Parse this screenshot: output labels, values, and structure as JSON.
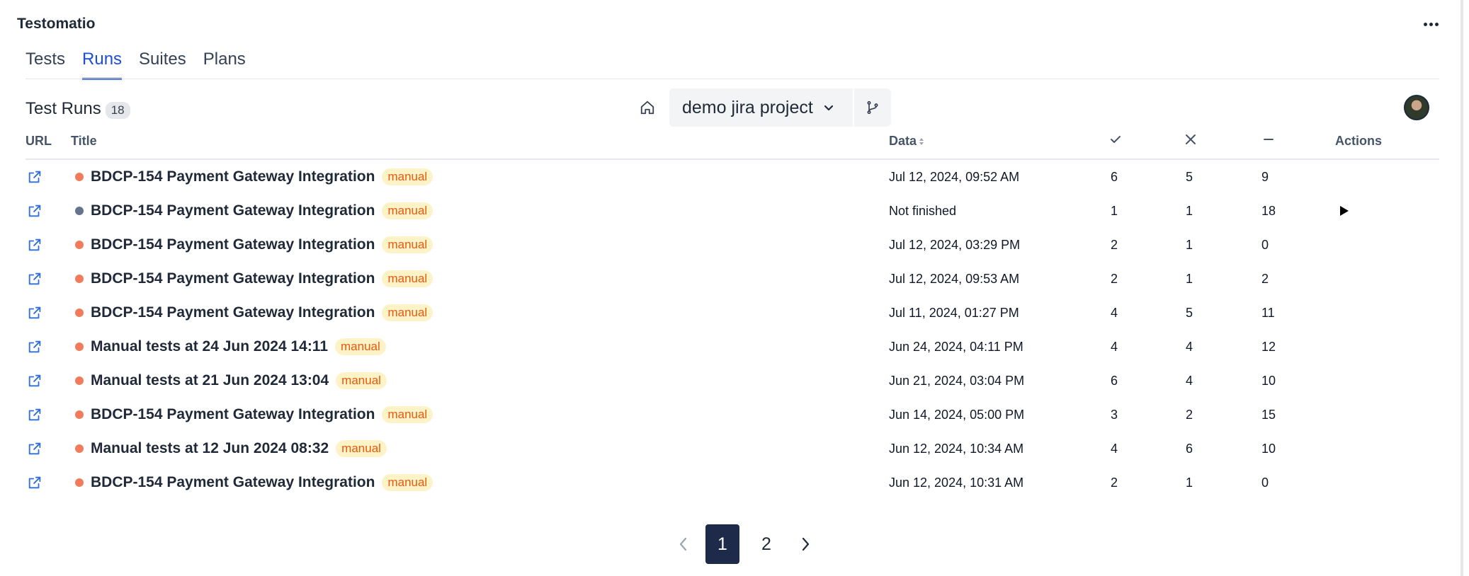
{
  "app": {
    "title": "Testomatio"
  },
  "tabs": [
    {
      "label": "Tests"
    },
    {
      "label": "Runs"
    },
    {
      "label": "Suites"
    },
    {
      "label": "Plans"
    }
  ],
  "header": {
    "title": "Test Runs",
    "count": "18",
    "project": "demo jira project"
  },
  "columns": {
    "url": "URL",
    "title": "Title",
    "date": "Data",
    "actions": "Actions"
  },
  "status_colors": {
    "finished": "#f07c5a",
    "unfinished": "#64748b"
  },
  "rows": [
    {
      "title": "BDCP-154 Payment Gateway Integration",
      "badge": "manual",
      "date": "Jul 12, 2024, 09:52 AM",
      "passed": "6",
      "failed": "5",
      "skipped": "9",
      "status": "finished"
    },
    {
      "title": "BDCP-154 Payment Gateway Integration",
      "badge": "manual",
      "date": "Not finished",
      "passed": "1",
      "failed": "1",
      "skipped": "18",
      "status": "unfinished"
    },
    {
      "title": "BDCP-154 Payment Gateway Integration",
      "badge": "manual",
      "date": "Jul 12, 2024, 03:29 PM",
      "passed": "2",
      "failed": "1",
      "skipped": "0",
      "status": "finished"
    },
    {
      "title": "BDCP-154 Payment Gateway Integration",
      "badge": "manual",
      "date": "Jul 12, 2024, 09:53 AM",
      "passed": "2",
      "failed": "1",
      "skipped": "2",
      "status": "finished"
    },
    {
      "title": "BDCP-154 Payment Gateway Integration",
      "badge": "manual",
      "date": "Jul 11, 2024, 01:27 PM",
      "passed": "4",
      "failed": "5",
      "skipped": "11",
      "status": "finished"
    },
    {
      "title": "Manual tests at 24 Jun 2024 14:11",
      "badge": "manual",
      "date": "Jun 24, 2024, 04:11 PM",
      "passed": "4",
      "failed": "4",
      "skipped": "12",
      "status": "finished"
    },
    {
      "title": "Manual tests at 21 Jun 2024 13:04",
      "badge": "manual",
      "date": "Jun 21, 2024, 03:04 PM",
      "passed": "6",
      "failed": "4",
      "skipped": "10",
      "status": "finished"
    },
    {
      "title": "BDCP-154 Payment Gateway Integration",
      "badge": "manual",
      "date": "Jun 14, 2024, 05:00 PM",
      "passed": "3",
      "failed": "2",
      "skipped": "15",
      "status": "finished"
    },
    {
      "title": "Manual tests at 12 Jun 2024 08:32",
      "badge": "manual",
      "date": "Jun 12, 2024, 10:34 AM",
      "passed": "4",
      "failed": "6",
      "skipped": "10",
      "status": "finished"
    },
    {
      "title": "BDCP-154 Payment Gateway Integration",
      "badge": "manual",
      "date": "Jun 12, 2024, 10:31 AM",
      "passed": "2",
      "failed": "1",
      "skipped": "0",
      "status": "finished"
    }
  ],
  "pagination": {
    "pages": [
      "1",
      "2"
    ],
    "current": "1"
  }
}
